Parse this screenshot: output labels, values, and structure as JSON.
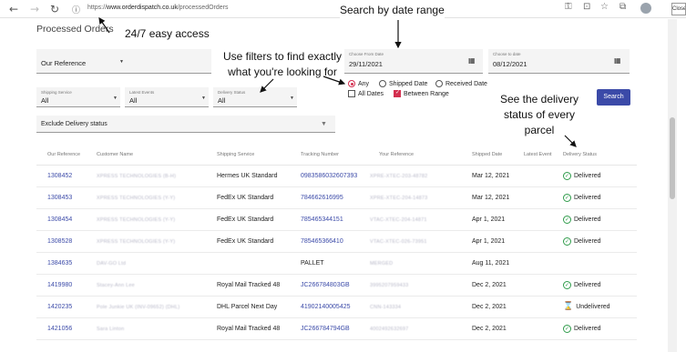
{
  "browser": {
    "url_prefix": "https://",
    "url_domain": "www.orderdispatch.co.uk",
    "url_path": "/processedOrders",
    "close_label": "Close"
  },
  "page": {
    "title": "Processed Orders"
  },
  "filters": {
    "reference_select": "Our Reference",
    "from_date_label": "Choose From Date",
    "from_date": "29/11/2021",
    "to_date_label": "Choose to date",
    "to_date": "08/12/2021",
    "shipping_service_label": "Shipping Service",
    "shipping_service_value": "All",
    "latest_events_label": "Latest Events",
    "latest_events_value": "All",
    "delivery_status_label": "Delivery Status",
    "delivery_status_value": "All",
    "radio_any": "Any",
    "radio_shipped": "Shipped Date",
    "radio_received": "Received Date",
    "check_all_dates": "All Dates",
    "check_between": "Between Range",
    "search_button": "Search",
    "exclude_select": "Exclude Delivery status"
  },
  "table": {
    "headers": [
      "Our Reference",
      "Customer Name",
      "Shipping Service",
      "Tracking Number",
      "Your Reference",
      "Shipped Date",
      "Latest Event",
      "Delivery Status"
    ],
    "rows": [
      {
        "ref": "1308452",
        "customer": "XPRESS TECHNOLOGIES (B-H)",
        "service": "Hermes UK Standard",
        "tracking": "0983586032607393",
        "your_ref": "XPRE-XTEC-203-48782",
        "shipped": "Mar 12, 2021",
        "status": "Delivered",
        "status_type": "ok"
      },
      {
        "ref": "1308453",
        "customer": "XPRESS TECHNOLOGIES (Y-Y)",
        "service": "FedEx UK Standard",
        "tracking": "784662616995",
        "your_ref": "XPRE-XTEC-204-14873",
        "shipped": "Mar 12, 2021",
        "status": "Delivered",
        "status_type": "ok"
      },
      {
        "ref": "1308454",
        "customer": "XPRESS TECHNOLOGIES (Y-Y)",
        "service": "FedEx UK Standard",
        "tracking": "785465344151",
        "your_ref": "VTAC-XTEC-204-14871",
        "shipped": "Apr 1, 2021",
        "status": "Delivered",
        "status_type": "ok"
      },
      {
        "ref": "1308528",
        "customer": "XPRESS TECHNOLOGIES (Y-Y)",
        "service": "FedEx UK Standard",
        "tracking": "785465366410",
        "your_ref": "VTAC-XTEC-026-73951",
        "shipped": "Apr 1, 2021",
        "status": "Delivered",
        "status_type": "ok"
      },
      {
        "ref": "1384635",
        "customer": "DAV-GO Ltd",
        "service": "",
        "tracking": "PALLET",
        "your_ref": "MERGED",
        "shipped": "Aug 11, 2021",
        "status": "",
        "status_type": "none"
      },
      {
        "ref": "1419980",
        "customer": "Stacey-Ann Lee",
        "service": "Royal Mail Tracked 48",
        "tracking": "JC266784803GB",
        "your_ref": "3995207959433",
        "shipped": "Dec 2, 2021",
        "status": "Delivered",
        "status_type": "ok"
      },
      {
        "ref": "1420235",
        "customer": "Pole Junkie UK (INV-09652) (DHL)",
        "service": "DHL Parcel Next Day",
        "tracking": "41902140005425",
        "your_ref": "CNN-143334",
        "shipped": "Dec 2, 2021",
        "status": "Undelivered",
        "status_type": "pending"
      },
      {
        "ref": "1421056",
        "customer": "Sara Linton",
        "service": "Royal Mail Tracked 48",
        "tracking": "JC266784794GB",
        "your_ref": "4002492632697",
        "shipped": "Dec 2, 2021",
        "status": "Delivered",
        "status_type": "ok"
      }
    ]
  },
  "annotations": {
    "easy_access": "24/7 easy access",
    "date_range": "Search by date range",
    "filters_line1": "Use filters to find exactly",
    "filters_line2": "what you're looking for",
    "status_line1": "See the delivery",
    "status_line2": "status of every",
    "status_line3": "parcel"
  },
  "colors": {
    "accent": "#3b4aa8",
    "link": "#3b4aa8",
    "selected": "#d32f4f",
    "delivered": "#2e9b4a",
    "undelivered": "#e53935"
  }
}
